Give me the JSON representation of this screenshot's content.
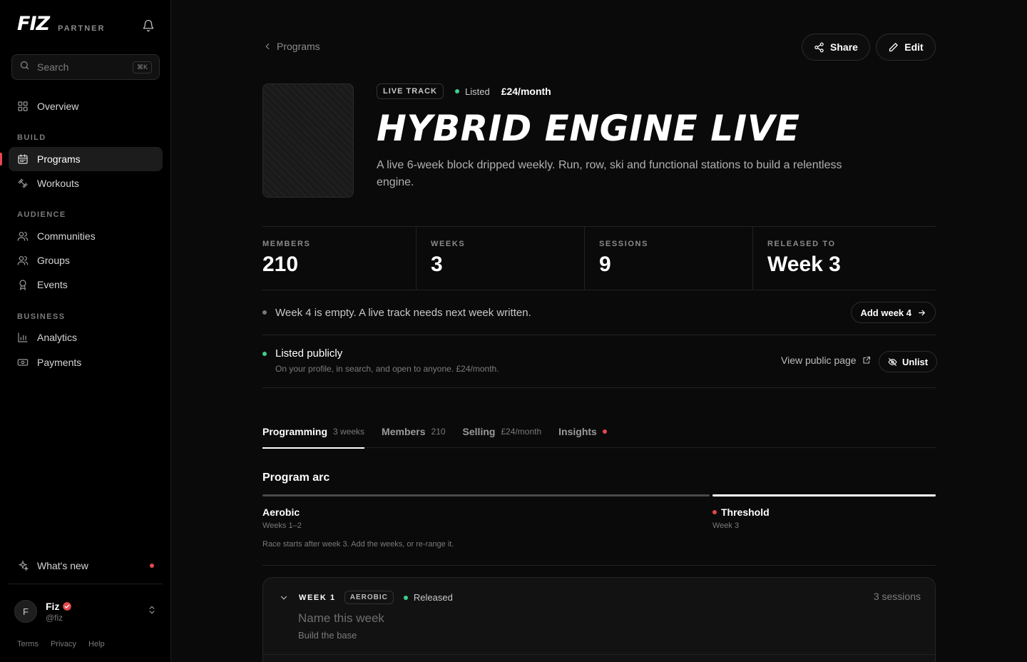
{
  "brand": {
    "logo": "FIZ",
    "sub": "PARTNER"
  },
  "search": {
    "placeholder": "Search",
    "shortcut": "⌘K"
  },
  "sidebar": {
    "overview": "Overview",
    "sections": {
      "build": "BUILD",
      "audience": "AUDIENCE",
      "business": "BUSINESS"
    },
    "items": {
      "programs": "Programs",
      "workouts": "Workouts",
      "communities": "Communities",
      "groups": "Groups",
      "events": "Events",
      "analytics": "Analytics",
      "payments": "Payments"
    },
    "whats_new": "What's new",
    "user": {
      "initial": "F",
      "name": "Fiz",
      "handle": "@fiz"
    },
    "footer": {
      "terms": "Terms",
      "privacy": "Privacy",
      "help": "Help"
    }
  },
  "header": {
    "back_label": "Programs",
    "share_label": "Share",
    "edit_label": "Edit"
  },
  "program": {
    "type_pill": "LIVE TRACK",
    "listed_status": "Listed",
    "price": "£24/month",
    "title": "HYBRID ENGINE LIVE",
    "description": "A live 6-week block dripped weekly. Run, row, ski and functional stations to build a relentless engine."
  },
  "stats": [
    {
      "label": "MEMBERS",
      "value": "210"
    },
    {
      "label": "WEEKS",
      "value": "3"
    },
    {
      "label": "SESSIONS",
      "value": "9"
    },
    {
      "label": "RELEASED TO",
      "value": "Week 3"
    }
  ],
  "notice": {
    "text": "Week 4 is empty. A live track needs next week written.",
    "action": "Add week 4"
  },
  "listing": {
    "title": "Listed publicly",
    "subtitle": "On your profile, in search, and open to anyone. £24/month.",
    "view_public": "View public page",
    "unlist": "Unlist"
  },
  "tabs": [
    {
      "label": "Programming",
      "count": "3 weeks"
    },
    {
      "label": "Members",
      "count": "210"
    },
    {
      "label": "Selling",
      "count": "£24/month"
    },
    {
      "label": "Insights",
      "count": ""
    }
  ],
  "arc": {
    "title": "Program arc",
    "phases": [
      {
        "name": "Aerobic",
        "weeks": "Weeks 1–2"
      },
      {
        "name": "Threshold",
        "weeks": "Week 3"
      }
    ],
    "note": "Race starts after week 3. Add the weeks, or re-range it."
  },
  "week_card": {
    "label": "WEEK 1",
    "phase_pill": "AEROBIC",
    "status": "Released",
    "sessions": "3 sessions",
    "name_placeholder": "Name this week",
    "subtitle": "Build the base"
  },
  "colors": {
    "accent_red": "#e5484d",
    "status_green": "#3ecf8e",
    "background": "#0a0a0a",
    "sidebar_bg": "#000000"
  }
}
